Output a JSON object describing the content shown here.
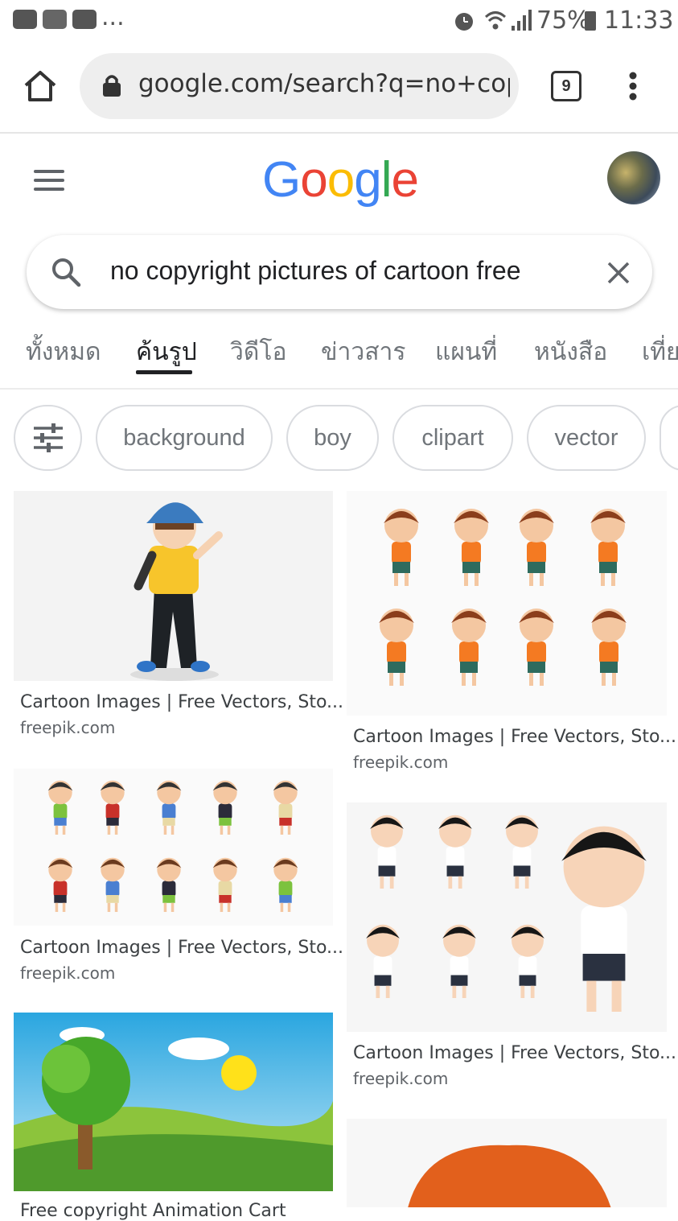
{
  "status_bar": {
    "battery": "75%",
    "time": "11:33",
    "more": "..."
  },
  "browser": {
    "url": "google.com/search?q=no+copyr",
    "tab_count": "9"
  },
  "google": {
    "logo": [
      "G",
      "o",
      "o",
      "g",
      "l",
      "e"
    ],
    "logo_colors": [
      "#4285F4",
      "#EA4335",
      "#FBBC05",
      "#4285F4",
      "#34A853",
      "#EA4335"
    ],
    "search_query": "no copyright pictures of cartoon free"
  },
  "tabs": [
    "ทั้งหมด",
    "ค้นรูป",
    "วิดีโอ",
    "ข่าวสาร",
    "แผนที่",
    "หนังสือ",
    "เที่ย"
  ],
  "chips": [
    "background",
    "boy",
    "clipart",
    "vector"
  ],
  "results": [
    {
      "title": "Cartoon Images | Free Vectors, Sto...",
      "source": "freepik.com"
    },
    {
      "title": "Cartoon Images | Free Vectors, Sto...",
      "source": "freepik.com"
    },
    {
      "title": "Cartoon Images | Free Vectors, Sto...",
      "source": "freepik.com"
    },
    {
      "title": "Cartoon Images | Free Vectors, Sto...",
      "source": "freepik.com"
    },
    {
      "title": "Free copyright Animation Cart",
      "source": ""
    }
  ]
}
